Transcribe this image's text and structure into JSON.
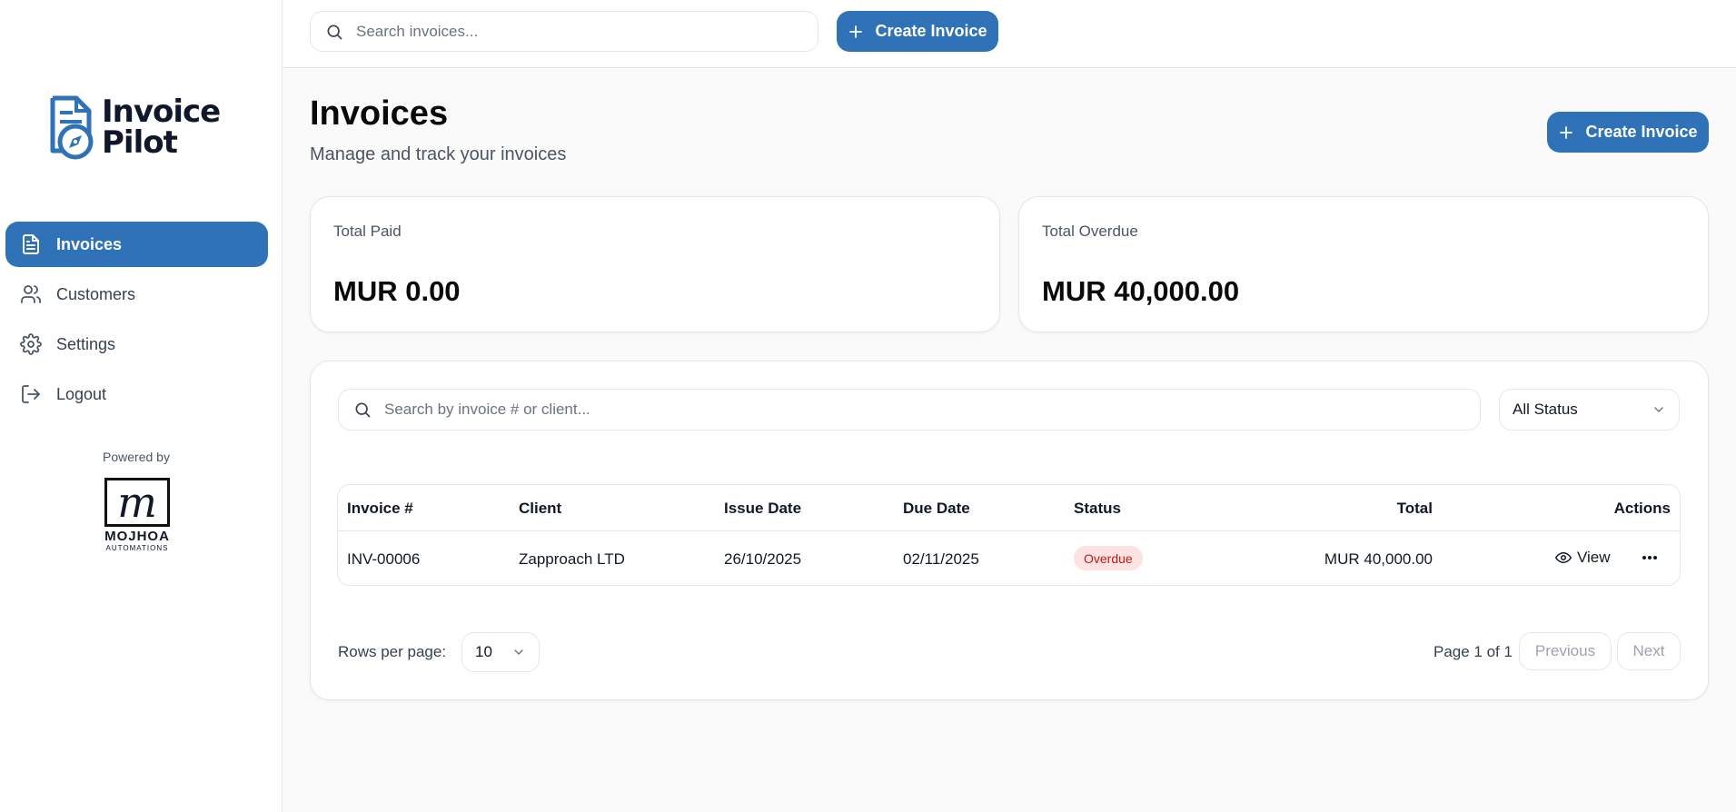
{
  "app": {
    "logo_text_line1": "Invoice",
    "logo_text_line2": "Pilot"
  },
  "sidebar": {
    "items": [
      {
        "label": "Invoices",
        "icon": "file-text-icon",
        "active": true
      },
      {
        "label": "Customers",
        "icon": "users-icon",
        "active": false
      },
      {
        "label": "Settings",
        "icon": "gear-icon",
        "active": false
      },
      {
        "label": "Logout",
        "icon": "logout-icon",
        "active": false
      }
    ],
    "powered_by": "Powered by",
    "partner_logo": {
      "mark": "m",
      "name": "MOJHOA",
      "sub": "AUTOMATIONS"
    }
  },
  "topbar": {
    "search_placeholder": "Search invoices...",
    "create_label": "Create Invoice"
  },
  "page": {
    "title": "Invoices",
    "subtitle": "Manage and track your invoices",
    "create_label": "Create Invoice"
  },
  "stats": [
    {
      "label": "Total Paid",
      "value": "MUR 0.00"
    },
    {
      "label": "Total Overdue",
      "value": "MUR 40,000.00"
    }
  ],
  "filters": {
    "search_placeholder": "Search by invoice # or client...",
    "status_selected": "All Status"
  },
  "table": {
    "columns": [
      "Invoice #",
      "Client",
      "Issue Date",
      "Due Date",
      "Status",
      "Total",
      "Actions"
    ],
    "rows": [
      {
        "invoice": "INV-00006",
        "client": "Zapproach LTD",
        "issue_date": "26/10/2025",
        "due_date": "02/11/2025",
        "status": "Overdue",
        "total": "MUR 40,000.00",
        "view_label": "View"
      }
    ]
  },
  "pagination": {
    "rows_label": "Rows per page:",
    "rows_value": "10",
    "page_info": "Page 1 of 1",
    "previous_label": "Previous",
    "next_label": "Next"
  },
  "colors": {
    "primary": "#2f72b7",
    "overdue_bg": "#fde2e2",
    "overdue_text": "#b91c1c"
  }
}
